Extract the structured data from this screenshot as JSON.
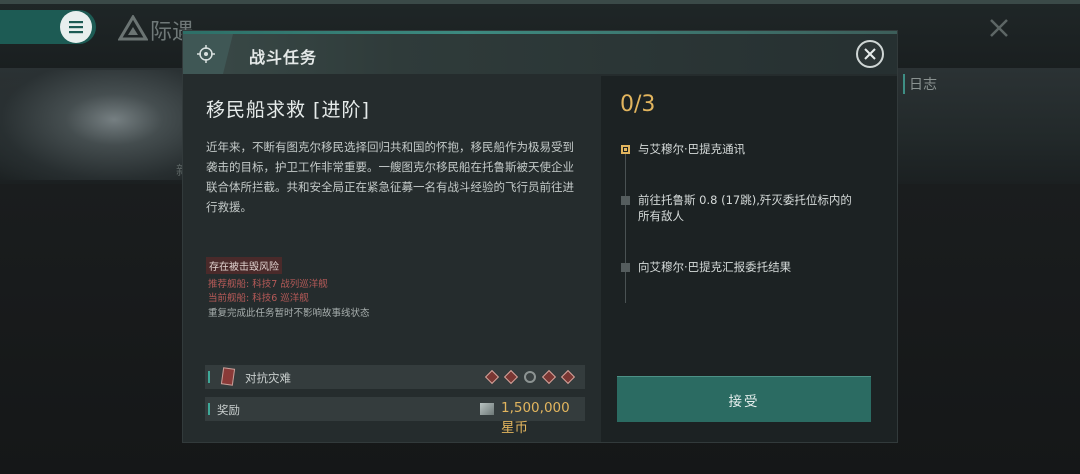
{
  "background": {
    "title": "际遇",
    "side_char": "新",
    "log_label": "日志"
  },
  "dialog": {
    "header_title": "战斗任务",
    "mission_name": "移民船求救 [进阶]",
    "description": "近年来，不断有图克尔移民选择回归共和国的怀抱，移民船作为极易受到袭击的目标，护卫工作非常重要。一艘图克尔移民船在托鲁斯被天使企业联合体所拦截。共和安全局正在紧急征募一名有战斗经验的飞行员前往进行救援。",
    "risk_badge": "存在被击毁风险",
    "recommended_ship": "推荐舰船: 科技7 战列巡洋舰",
    "current_ship": "当前舰船: 科技6 巡洋舰",
    "repeat_note": "重复完成此任务暂时不影响故事线状态",
    "disaster_label": "对抗灾难",
    "difficulty_pips": [
      "diamond",
      "diamond",
      "circle",
      "diamond",
      "diamond"
    ],
    "reward_label": "奖励",
    "reward_amount": "1,500,000 星币",
    "progress": "0/3",
    "objectives": [
      {
        "text": "与艾穆尔·巴提克通讯",
        "active": true
      },
      {
        "text": "前往托鲁斯 0.8 (17跳),歼灭委托位标内的所有敌人",
        "active": false
      },
      {
        "text": "向艾穆尔·巴提克汇报委托结果",
        "active": false
      }
    ],
    "accept_label": "接受"
  },
  "colors": {
    "accent_teal": "#2b6b62",
    "gold": "#e2b55e",
    "danger": "#b65a58"
  }
}
